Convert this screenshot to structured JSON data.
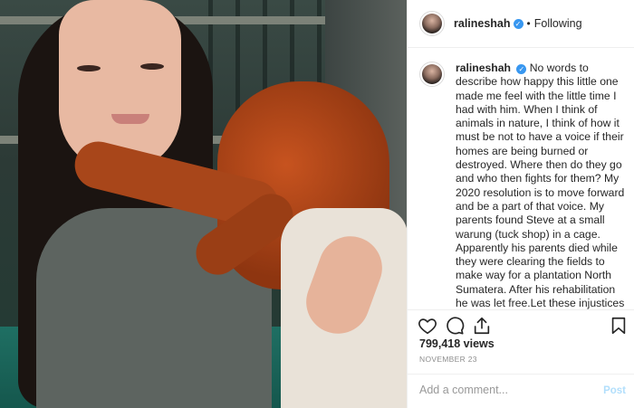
{
  "post": {
    "username": "ralineshah",
    "verified_icon": "verified-badge-icon",
    "separator": "•",
    "follow_status": "Following",
    "caption": "No words to describe how happy this little one made me feel with the little time I had with him. When I think of animals in nature, I think of how it must be not to have a voice if their homes are being burned or destroyed. Where then do they go and who then fights for them? My 2020 resolution is to move forward and be a part of that voice. My parents found Steve at a small warung (tuck shop) in a cage. Apparently his parents died while they were clearing the fields to make way for a plantation North Sumatera. After his rehabilitation he was let free.Let these injustices to innocent wildlife not happen on our watch. They hurt like we do.",
    "views": "799,418 views",
    "date": "NOVEMBER 23"
  },
  "actions": {
    "like_icon": "heart-icon",
    "comment_icon": "comment-bubble-icon",
    "share_icon": "share-icon",
    "save_icon": "bookmark-icon"
  },
  "comment_box": {
    "placeholder": "Add a comment...",
    "post_label": "Post"
  },
  "colors": {
    "verified": "#3897f0",
    "post_disabled": "#b2dffc",
    "border": "#efefef",
    "muted": "#8e8e8e"
  }
}
